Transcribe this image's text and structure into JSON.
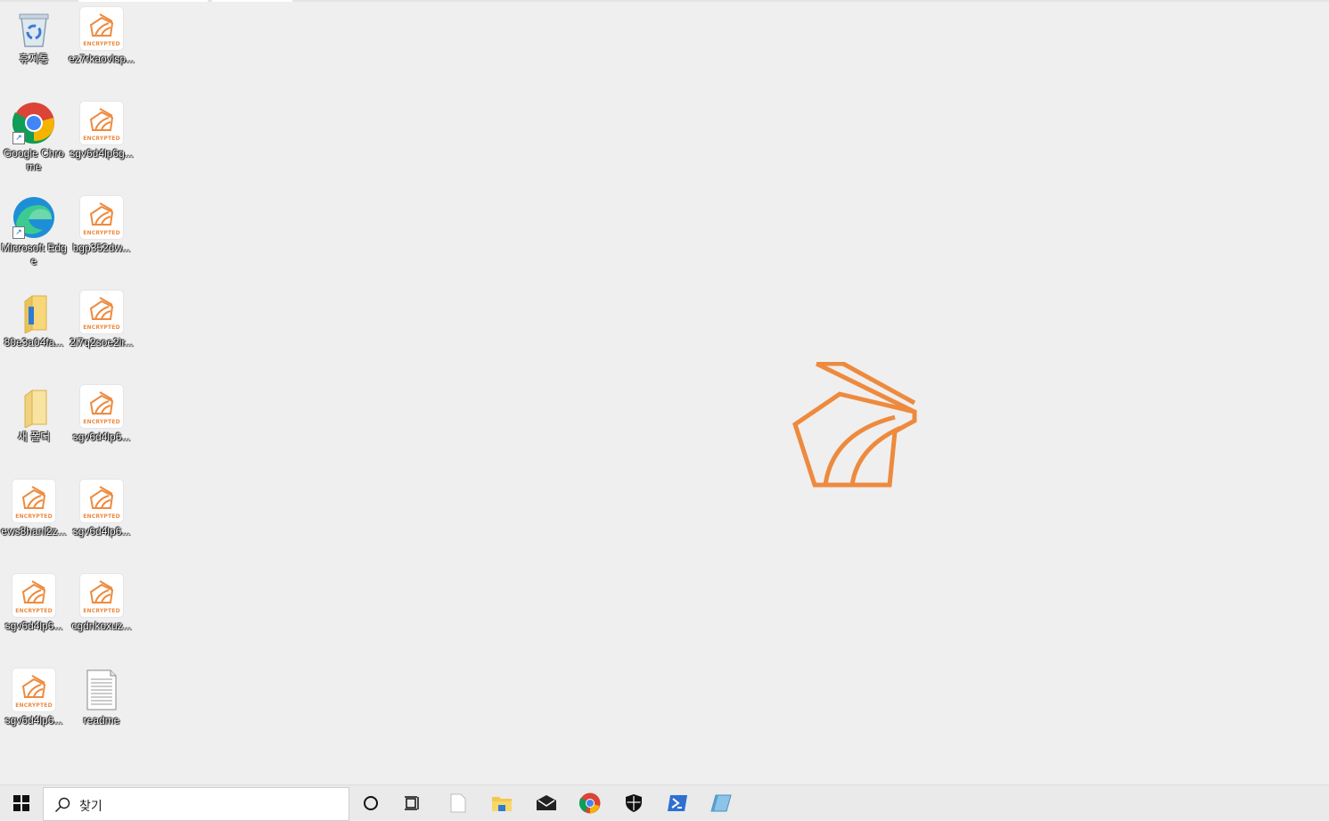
{
  "desktop": {
    "icons": [
      {
        "label": "휴지통",
        "kind": "recycle-bin"
      },
      {
        "label": "ez7rkaovlsp...",
        "kind": "encrypted-file",
        "badge": "ENCRYPTED"
      },
      {
        "label": "Google Chrome",
        "kind": "chrome-shortcut"
      },
      {
        "label": "sgv6d4lp6g...",
        "kind": "encrypted-file",
        "badge": "ENCRYPTED"
      },
      {
        "label": "Microsoft Edge",
        "kind": "edge-shortcut"
      },
      {
        "label": "bgp352dw...",
        "kind": "encrypted-file",
        "badge": "ENCRYPTED"
      },
      {
        "label": "80e3a04fa...",
        "kind": "folder"
      },
      {
        "label": "2i7q2soe2ir...",
        "kind": "encrypted-file",
        "badge": "ENCRYPTED"
      },
      {
        "label": "새 폴더",
        "kind": "folder-empty"
      },
      {
        "label": "sgv6d4lp6...",
        "kind": "encrypted-file",
        "badge": "ENCRYPTED"
      },
      {
        "label": "ews8hanl2z...",
        "kind": "encrypted-file",
        "badge": "ENCRYPTED"
      },
      {
        "label": "sgv6d4lp6...",
        "kind": "encrypted-file",
        "badge": "ENCRYPTED"
      },
      {
        "label": "sgv6d4lp6...",
        "kind": "encrypted-file",
        "badge": "ENCRYPTED"
      },
      {
        "label": "cgdnkoxuz...",
        "kind": "encrypted-file",
        "badge": "ENCRYPTED"
      },
      {
        "label": "sgv6d4lp6...",
        "kind": "encrypted-file",
        "badge": "ENCRYPTED"
      },
      {
        "label": "readme",
        "kind": "text-file"
      }
    ],
    "wallpaper_logo": "ransomware-logo-icon",
    "accent_color": "#ee8a3e"
  },
  "taskbar": {
    "search_placeholder": "찾기",
    "items": [
      {
        "name": "start-button",
        "icon": "windows-logo-icon"
      },
      {
        "name": "cortana-button",
        "icon": "circle-icon"
      },
      {
        "name": "task-view-button",
        "icon": "task-view-icon"
      },
      {
        "name": "notepad-button",
        "icon": "blank-page-icon"
      },
      {
        "name": "file-explorer-button",
        "icon": "folder-icon"
      },
      {
        "name": "mail-button",
        "icon": "envelope-icon"
      },
      {
        "name": "chrome-button",
        "icon": "chrome-icon"
      },
      {
        "name": "security-button",
        "icon": "shield-icon"
      },
      {
        "name": "powershell-button",
        "icon": "powershell-icon"
      },
      {
        "name": "app-button",
        "icon": "blue-tile-icon"
      }
    ]
  }
}
